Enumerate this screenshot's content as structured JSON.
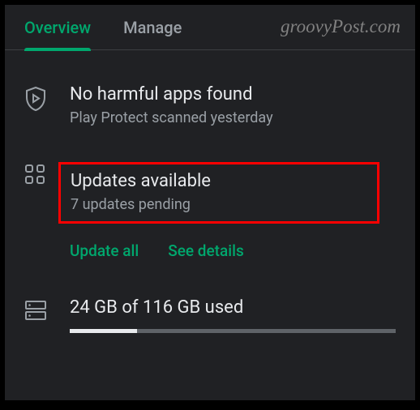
{
  "tabs": {
    "overview": "Overview",
    "manage": "Manage"
  },
  "watermark": "groovyPost.com",
  "protect": {
    "title": "No harmful apps found",
    "subtitle": "Play Protect scanned yesterday"
  },
  "updates": {
    "title": "Updates available",
    "subtitle": "7 updates pending",
    "update_all": "Update all",
    "see_details": "See details"
  },
  "storage": {
    "title": "24 GB of 116 GB used",
    "used_percent": 20.7
  }
}
